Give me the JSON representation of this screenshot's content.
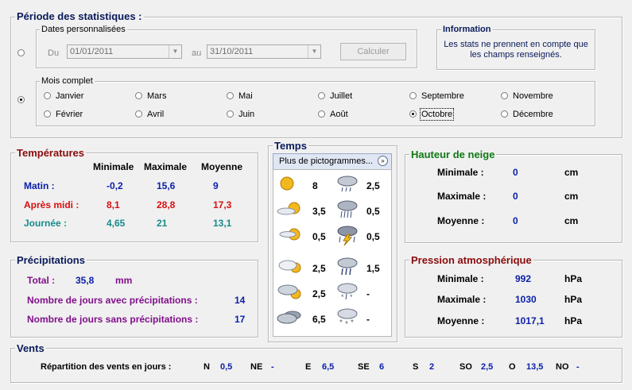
{
  "periode": {
    "title": "Période des statistiques :",
    "dates_group": "Dates personnalisées",
    "du_label": "Du",
    "du_value": "01/01/2011",
    "au_label": "au",
    "au_value": "31/10/2011",
    "calculer": "Calculer",
    "mois_group": "Mois complet",
    "months": [
      "Janvier",
      "Mars",
      "Mai",
      "Juillet",
      "Septembre",
      "Novembre",
      "Février",
      "Avril",
      "Juin",
      "Août",
      "Octobre",
      "Décembre"
    ],
    "selected_month": "Octobre"
  },
  "information": {
    "title": "Information",
    "text": "Les stats ne prennent en compte que les champs renseignés."
  },
  "temperatures": {
    "title": "Températures",
    "col_min": "Minimale",
    "col_max": "Maximale",
    "col_avg": "Moyenne",
    "rows": [
      {
        "label": "Matin :",
        "min": "-0,2",
        "max": "15,6",
        "avg": "9"
      },
      {
        "label": "Après midi :",
        "min": "8,1",
        "max": "28,8",
        "avg": "17,3"
      },
      {
        "label": "Journée :",
        "min": "4,65",
        "max": "21",
        "avg": "13,1"
      }
    ]
  },
  "temps": {
    "title": "Temps",
    "dropdown": "Plus de pictogrammes...",
    "left": [
      {
        "icon": "sun-icon",
        "value": "8"
      },
      {
        "icon": "sun-cloud-icon",
        "value": "3,5"
      },
      {
        "icon": "cloud-sun-icon",
        "value": "0,5"
      },
      {
        "icon": "partly-cloudy-icon",
        "value": "2,5"
      },
      {
        "icon": "mostly-cloudy-icon",
        "value": "2,5"
      },
      {
        "icon": "overcast-icon",
        "value": "6,5"
      }
    ],
    "right": [
      {
        "icon": "drizzle-icon",
        "value": "2,5"
      },
      {
        "icon": "rain-icon",
        "value": "0,5"
      },
      {
        "icon": "thunderstorm-icon",
        "value": "0,5"
      },
      {
        "icon": "heavy-rain-icon",
        "value": "1,5"
      },
      {
        "icon": "sleet-icon",
        "value": "-"
      },
      {
        "icon": "snow-icon",
        "value": "-"
      }
    ]
  },
  "neige": {
    "title": "Hauteur de neige",
    "rows": [
      {
        "label": "Minimale :",
        "value": "0",
        "unit": "cm"
      },
      {
        "label": "Maximale :",
        "value": "0",
        "unit": "cm"
      },
      {
        "label": "Moyenne :",
        "value": "0",
        "unit": "cm"
      }
    ]
  },
  "precipitations": {
    "title": "Précipitations",
    "total_label": "Total :",
    "total_value": "35,8",
    "total_unit": "mm",
    "avec_label": "Nombre de jours avec précipitations :",
    "avec_value": "14",
    "sans_label": "Nombre de jours sans précipitations :",
    "sans_value": "17"
  },
  "pression": {
    "title": "Pression atmosphérique",
    "rows": [
      {
        "label": "Minimale :",
        "value": "992",
        "unit": "hPa"
      },
      {
        "label": "Maximale :",
        "value": "1030",
        "unit": "hPa"
      },
      {
        "label": "Moyenne :",
        "value": "1017,1",
        "unit": "hPa"
      }
    ]
  },
  "vents": {
    "title": "Vents",
    "label": "Répartition des vents en jours :",
    "dirs": [
      {
        "dir": "N",
        "value": "0,5"
      },
      {
        "dir": "NE",
        "value": "-"
      },
      {
        "dir": "E",
        "value": "6,5"
      },
      {
        "dir": "SE",
        "value": "6"
      },
      {
        "dir": "S",
        "value": "2"
      },
      {
        "dir": "SO",
        "value": "2,5"
      },
      {
        "dir": "O",
        "value": "13,5"
      },
      {
        "dir": "NO",
        "value": "-"
      }
    ]
  },
  "colors": {
    "value_blue": "#0a1ea8",
    "red": "#d80f0f",
    "teal": "#188a8a",
    "purple": "#80108a",
    "green_header": "#0e7a14",
    "dark_red_header": "#8a0c0c"
  }
}
